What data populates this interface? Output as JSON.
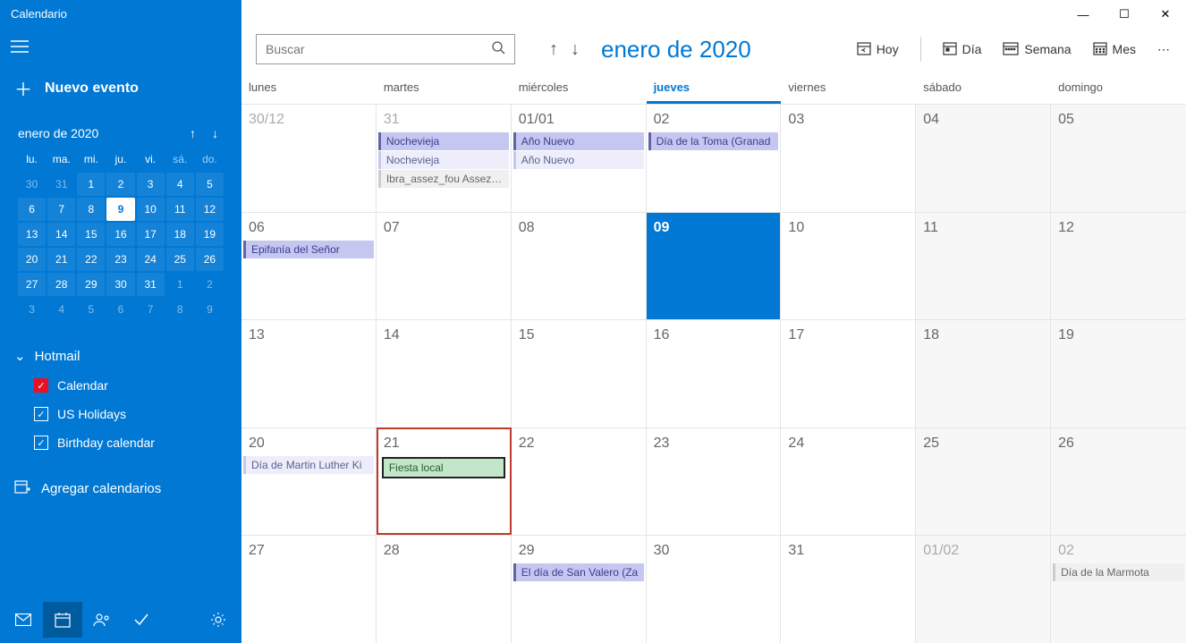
{
  "app_title": "Calendario",
  "new_event_label": "Nuevo evento",
  "mini_cal": {
    "title": "enero de 2020",
    "dow": [
      "lu.",
      "ma.",
      "mi.",
      "ju.",
      "vi.",
      "sá.",
      "do."
    ],
    "days": [
      {
        "n": "30",
        "dim": true
      },
      {
        "n": "31",
        "dim": true
      },
      {
        "n": "1"
      },
      {
        "n": "2"
      },
      {
        "n": "3"
      },
      {
        "n": "4"
      },
      {
        "n": "5"
      },
      {
        "n": "6"
      },
      {
        "n": "7"
      },
      {
        "n": "8"
      },
      {
        "n": "9",
        "today": true
      },
      {
        "n": "10"
      },
      {
        "n": "11"
      },
      {
        "n": "12"
      },
      {
        "n": "13"
      },
      {
        "n": "14"
      },
      {
        "n": "15"
      },
      {
        "n": "16"
      },
      {
        "n": "17"
      },
      {
        "n": "18"
      },
      {
        "n": "19"
      },
      {
        "n": "20"
      },
      {
        "n": "21"
      },
      {
        "n": "22"
      },
      {
        "n": "23"
      },
      {
        "n": "24"
      },
      {
        "n": "25"
      },
      {
        "n": "26"
      },
      {
        "n": "27"
      },
      {
        "n": "28"
      },
      {
        "n": "29"
      },
      {
        "n": "30"
      },
      {
        "n": "31"
      },
      {
        "n": "1",
        "dim": true
      },
      {
        "n": "2",
        "dim": true
      },
      {
        "n": "3",
        "dim": true
      },
      {
        "n": "4",
        "dim": true
      },
      {
        "n": "5",
        "dim": true
      },
      {
        "n": "6",
        "dim": true
      },
      {
        "n": "7",
        "dim": true
      },
      {
        "n": "8",
        "dim": true
      },
      {
        "n": "9",
        "dim": true
      }
    ]
  },
  "account_name": "Hotmail",
  "calendars": [
    {
      "label": "Calendar",
      "style": "red"
    },
    {
      "label": "US Holidays",
      "style": "white"
    },
    {
      "label": "Birthday calendar",
      "style": "white"
    }
  ],
  "add_calendars_label": "Agregar calendarios",
  "search_placeholder": "Buscar",
  "month_title": "enero de 2020",
  "toolbar": {
    "today": "Hoy",
    "day": "Día",
    "week": "Semana",
    "month": "Mes"
  },
  "dow_full": [
    "lunes",
    "martes",
    "miércoles",
    "jueves",
    "viernes",
    "sábado",
    "domingo"
  ],
  "today_index": 3,
  "grid": [
    [
      {
        "num": "30/12",
        "other": true
      },
      {
        "num": "31",
        "other": true,
        "events": [
          {
            "t": "Nochevieja",
            "c": "purple"
          },
          {
            "t": "Nochevieja",
            "c": "purple-l"
          },
          {
            "t": "Ibra_assez_fou Assez's b",
            "c": "gray"
          }
        ]
      },
      {
        "num": "01/01",
        "events": [
          {
            "t": "Año Nuevo",
            "c": "purple"
          },
          {
            "t": "Año Nuevo",
            "c": "purple-l"
          }
        ]
      },
      {
        "num": "02",
        "events": [
          {
            "t": "Día de la Toma (Granad",
            "c": "purple"
          }
        ]
      },
      {
        "num": "03"
      },
      {
        "num": "04",
        "weekend": true
      },
      {
        "num": "05",
        "weekend": true
      }
    ],
    [
      {
        "num": "06",
        "events": [
          {
            "t": "Epifanía del Señor",
            "c": "purple"
          }
        ]
      },
      {
        "num": "07"
      },
      {
        "num": "08"
      },
      {
        "num": "09",
        "selected": true
      },
      {
        "num": "10"
      },
      {
        "num": "11",
        "weekend": true
      },
      {
        "num": "12",
        "weekend": true
      }
    ],
    [
      {
        "num": "13"
      },
      {
        "num": "14"
      },
      {
        "num": "15"
      },
      {
        "num": "16"
      },
      {
        "num": "17"
      },
      {
        "num": "18",
        "weekend": true
      },
      {
        "num": "19",
        "weekend": true
      }
    ],
    [
      {
        "num": "20",
        "events": [
          {
            "t": "Día de Martin Luther Ki",
            "c": "purple-l"
          }
        ]
      },
      {
        "num": "21",
        "highlight": true,
        "events": [
          {
            "t": "Fiesta local",
            "c": "green"
          }
        ]
      },
      {
        "num": "22"
      },
      {
        "num": "23"
      },
      {
        "num": "24"
      },
      {
        "num": "25",
        "weekend": true
      },
      {
        "num": "26",
        "weekend": true
      }
    ],
    [
      {
        "num": "27"
      },
      {
        "num": "28"
      },
      {
        "num": "29",
        "events": [
          {
            "t": "El día de San Valero (Za",
            "c": "purple"
          }
        ]
      },
      {
        "num": "30"
      },
      {
        "num": "31"
      },
      {
        "num": "01/02",
        "other": true,
        "weekend": true
      },
      {
        "num": "02",
        "other": true,
        "weekend": true,
        "events": [
          {
            "t": "Día de la Marmota",
            "c": "gray"
          }
        ]
      }
    ]
  ]
}
